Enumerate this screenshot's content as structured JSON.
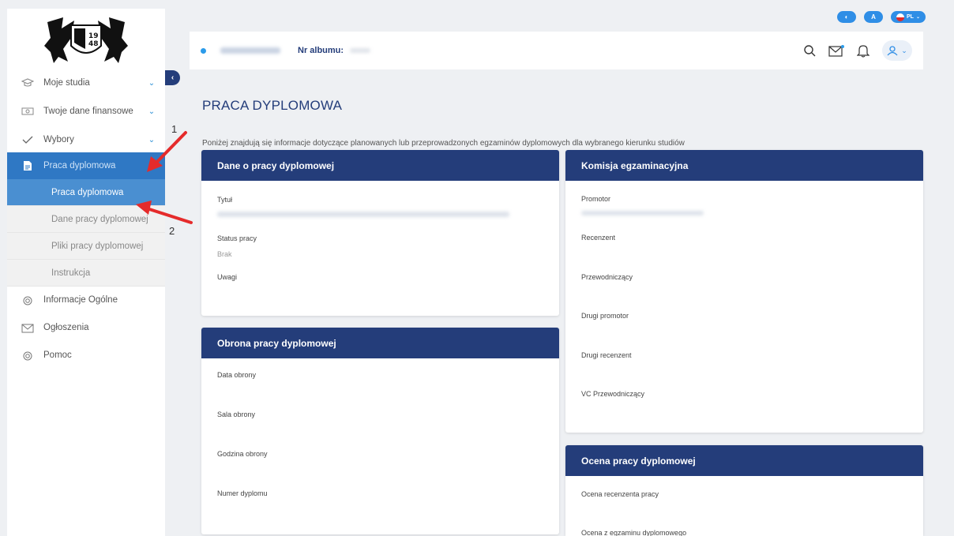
{
  "top_controls": {
    "contrast": "◐",
    "font": "A",
    "lang": "PL"
  },
  "header": {
    "album_label": "Nr albumu:"
  },
  "sidebar": {
    "items": [
      {
        "label": "Moje studia"
      },
      {
        "label": "Twoje dane finansowe"
      },
      {
        "label": "Wybory"
      },
      {
        "label": "Praca dyplomowa"
      }
    ],
    "sub_items": [
      {
        "label": "Praca dyplomowa"
      },
      {
        "label": "Dane pracy dyplomowej"
      },
      {
        "label": "Pliki pracy dyplomowej"
      },
      {
        "label": "Instrukcja"
      }
    ],
    "bottom_items": [
      {
        "label": "Informacje Ogólne"
      },
      {
        "label": "Ogłoszenia"
      },
      {
        "label": "Pomoc"
      }
    ]
  },
  "main": {
    "title": "PRACA DYPLOMOWA",
    "intro": "Poniżej znajdują się informacje dotyczące planowanych lub przeprowadzonych egzaminów dyplomowych dla wybranego kierunku studiów"
  },
  "card_thesis": {
    "title": "Dane o pracy dyplomowej",
    "tytul_label": "Tytuł",
    "status_label": "Status pracy",
    "status_value": "Brak",
    "uwagi_label": "Uwagi"
  },
  "card_defense": {
    "title": "Obrona pracy dyplomowej",
    "data_label": "Data obrony",
    "sala_label": "Sala obrony",
    "godzina_label": "Godzina obrony",
    "numer_label": "Numer dyplomu"
  },
  "card_committee": {
    "title": "Komisja egzaminacyjna",
    "promotor_label": "Promotor",
    "recenzent_label": "Recenzent",
    "przew_label": "Przewodniczący",
    "drugi_promotor_label": "Drugi promotor",
    "drugi_recenzent_label": "Drugi recenzent",
    "vc_label": "VC Przewodniczący"
  },
  "card_grade": {
    "title": "Ocena pracy dyplomowej",
    "ocena_recenzenta_label": "Ocena recenzenta pracy",
    "ocena_egzaminu_label": "Ocena z egzaminu dyplomowego"
  },
  "annotations": {
    "one": "1",
    "two": "2"
  },
  "colors": {
    "navy": "#243d7a",
    "accent": "#2f8ee6",
    "active": "#2f78c4",
    "arrow": "#e52b2b"
  }
}
